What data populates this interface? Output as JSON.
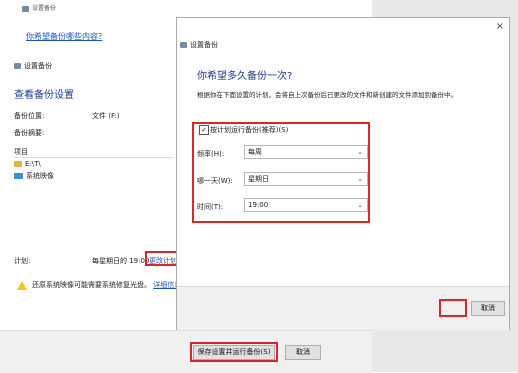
{
  "background_window": {
    "title": "设置备份",
    "top_link": "你希望备份哪些内容?",
    "section_label": "设置备份",
    "heading": "查看备份设置",
    "location_label": "备份位置:",
    "location_value": "文件 (F:)",
    "summary_label": "备份摘要:",
    "items_header": "项目",
    "items": [
      "E:\\T\\",
      "系统映像"
    ],
    "schedule_label": "计划:",
    "schedule_value": "每星期日的 19:00",
    "change_schedule_link": "更改计划",
    "warning_text": "还原系统映像可能需要系统修复光盘。",
    "details_link": "详细信息",
    "save_button": "保存设置并运行备份(S)",
    "cancel_button": "取消"
  },
  "dialog": {
    "close_glyph": "×",
    "title": "设置备份",
    "heading": "你希望多久备份一次?",
    "description": "根据你在下面设置的计划，会将自上次备份后已更改的文件和新创建的文件添加到备份中。",
    "checkbox_label": "按计划运行备份(推荐)(S)",
    "checkbox_mark": "✓",
    "frequency_label": "频率(H):",
    "frequency_value": "每周",
    "day_label": "哪一天(W):",
    "day_value": "星期日",
    "time_label": "时间(T):",
    "time_value": "19:00",
    "chevron": "⌄",
    "cancel_button": "取消"
  },
  "colors": {
    "accent": "#1a56b8",
    "highlight_red": "#d9262b",
    "footer_gray": "#f0f0f0"
  },
  "icons": [
    "backup-icon",
    "folder-icon",
    "system-image-icon",
    "warning-icon",
    "close-icon",
    "chevron-down-icon"
  ]
}
